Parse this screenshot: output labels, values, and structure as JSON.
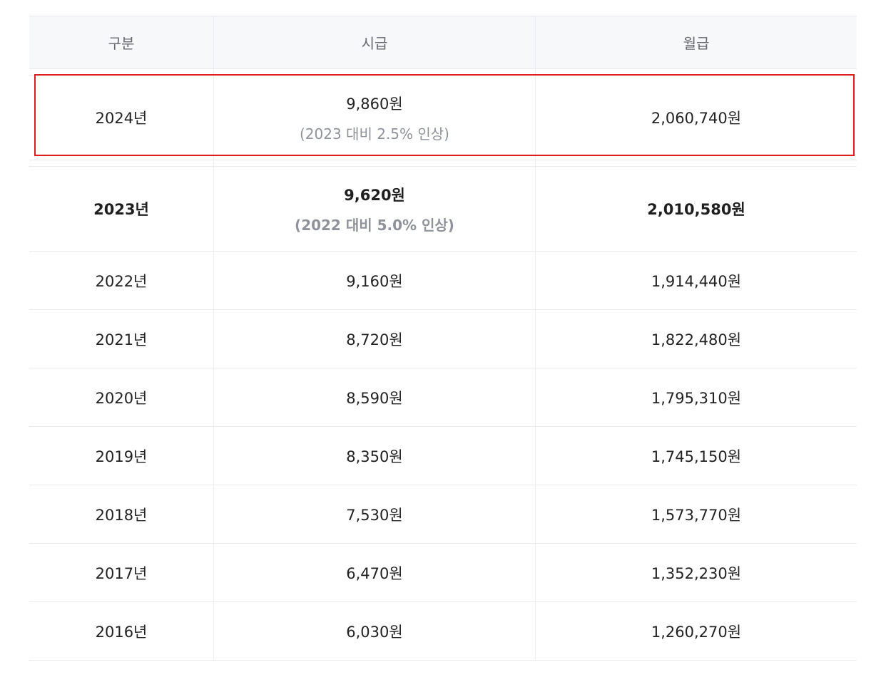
{
  "table": {
    "headers": [
      "구분",
      "시급",
      "월급"
    ],
    "highlight_row": {
      "year": "2024년",
      "hourly": "9,860원",
      "hourly_note": "(2023 대비 2.5% 인상)",
      "monthly": "2,060,740원"
    },
    "bold_row": {
      "year": "2023년",
      "hourly": "9,620원",
      "hourly_note": "(2022 대비 5.0% 인상)",
      "monthly": "2,010,580원"
    },
    "rows": [
      {
        "year": "2022년",
        "hourly": "9,160원",
        "monthly": "1,914,440원"
      },
      {
        "year": "2021년",
        "hourly": "8,720원",
        "monthly": "1,822,480원"
      },
      {
        "year": "2020년",
        "hourly": "8,590원",
        "monthly": "1,795,310원"
      },
      {
        "year": "2019년",
        "hourly": "8,350원",
        "monthly": "1,745,150원"
      },
      {
        "year": "2018년",
        "hourly": "7,530원",
        "monthly": "1,573,770원"
      },
      {
        "year": "2017년",
        "hourly": "6,470원",
        "monthly": "1,352,230원"
      },
      {
        "year": "2016년",
        "hourly": "6,030원",
        "monthly": "1,260,270원"
      }
    ]
  },
  "colors": {
    "highlight_border": "#e01b1b",
    "header_background": "#f7f8fa",
    "note_text": "#8f9399"
  }
}
